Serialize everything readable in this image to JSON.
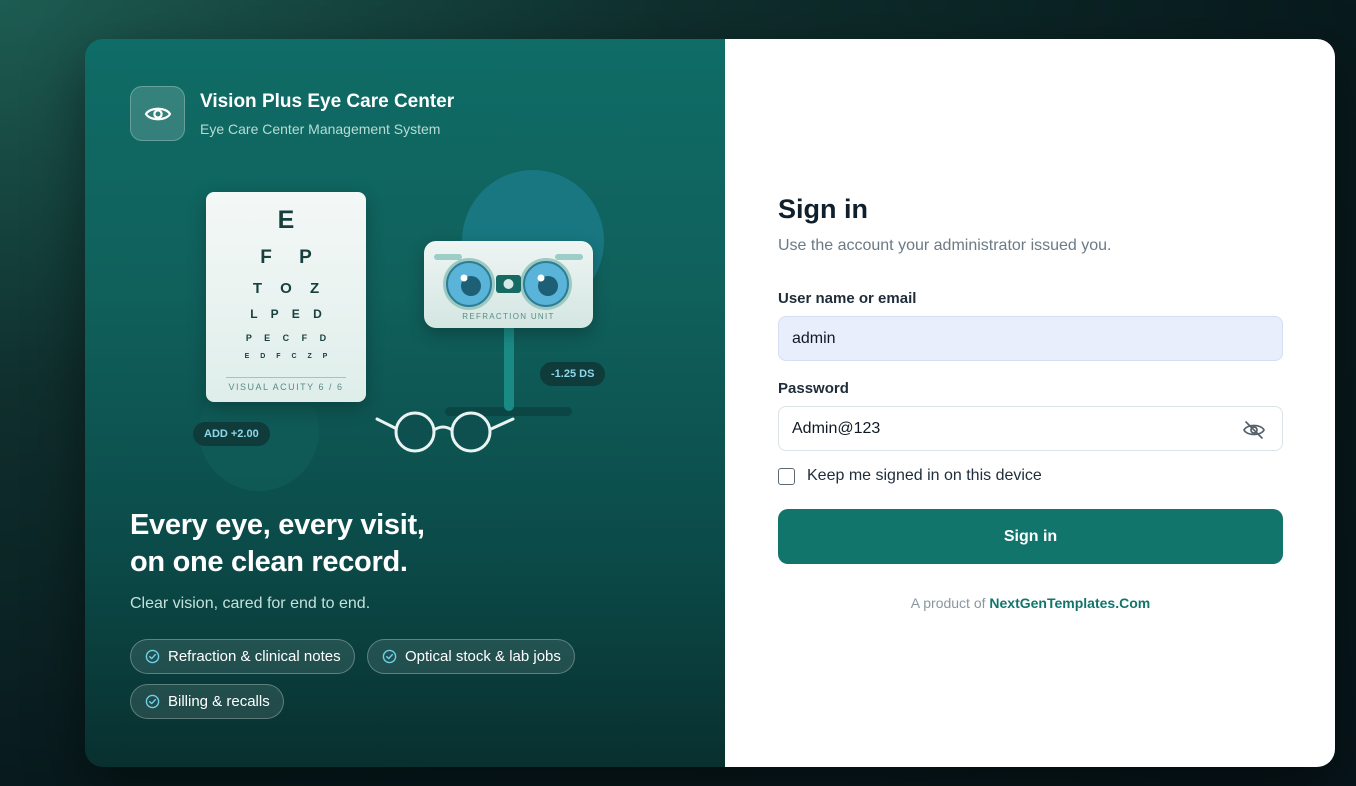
{
  "brand": {
    "name": "Vision Plus Eye Care Center",
    "subtitle": "Eye Care Center Management System"
  },
  "illustration": {
    "chart_rows": [
      "E",
      "F P",
      "T O Z",
      "L P E D",
      "P E C F D",
      "E D F C Z P"
    ],
    "chart_footer": "VISUAL ACUITY 6 / 6",
    "phoropter_label": "REFRACTION UNIT",
    "tag_right": "-1.25 DS",
    "tag_left": "ADD +2.00"
  },
  "hero": {
    "headline_line1": "Every eye, every visit,",
    "headline_line2": "on one clean record.",
    "subline": "Clear vision, cared for end to end.",
    "features": [
      "Refraction & clinical notes",
      "Optical stock & lab jobs",
      "Billing & recalls"
    ]
  },
  "signin": {
    "title": "Sign in",
    "subtitle": "Use the account your administrator issued you.",
    "username_label": "User name or email",
    "username_value": "admin",
    "password_label": "Password",
    "password_value": "Admin@123",
    "remember_label": "Keep me signed in on this device",
    "remember_checked": false,
    "button_label": "Sign in",
    "footer_prefix": "A product of",
    "footer_link": "NextGenTemplates.Com"
  },
  "icons": {
    "brand": "eye-icon",
    "password_toggle": "eye-off-icon",
    "feature_check": "check-circle-icon"
  },
  "colors": {
    "accent": "#12756c",
    "panel_top": "#0f6c66",
    "panel_bottom": "#08302f",
    "tag_text": "#8fd7ea"
  }
}
